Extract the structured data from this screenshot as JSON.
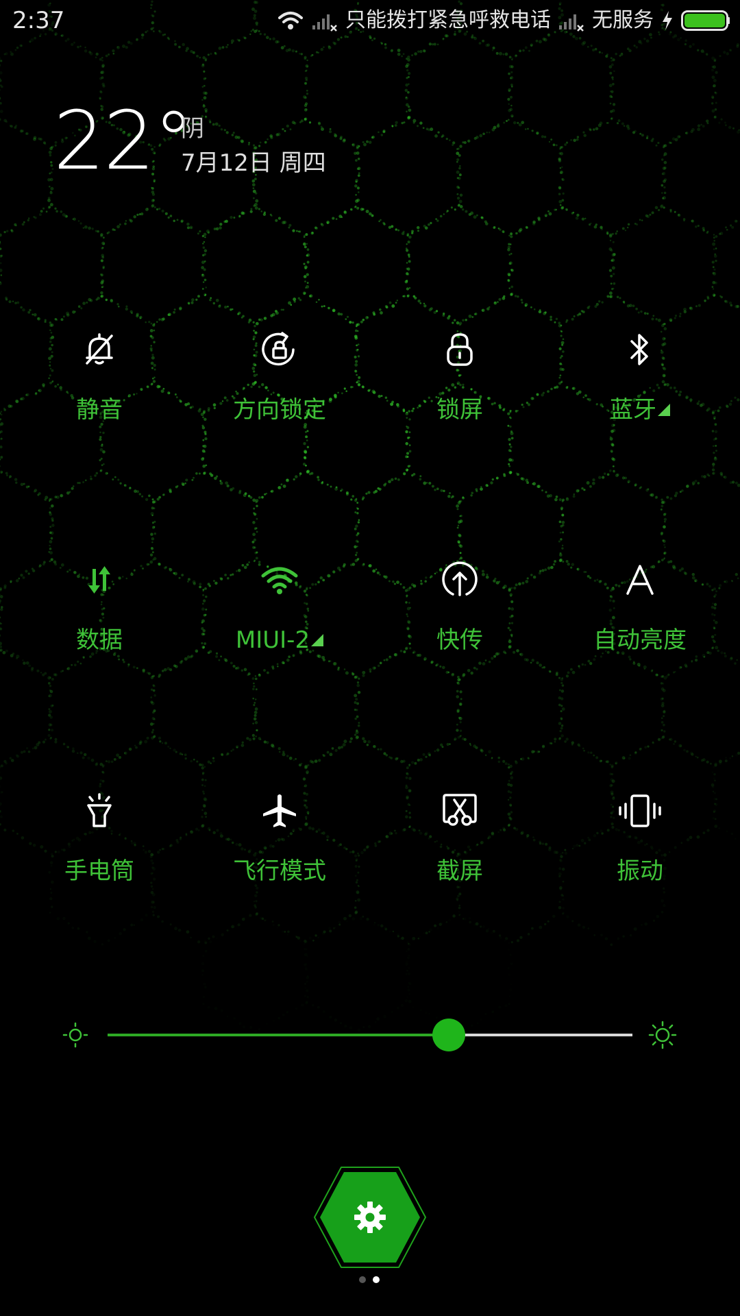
{
  "status_bar": {
    "time": "2:37",
    "carrier_text": "只能拨打紧急呼救电话",
    "service_text": "无服务",
    "battery_color": "#3cc11e"
  },
  "weather": {
    "temperature": "22°",
    "condition": "阴",
    "date": "7月12日 周四"
  },
  "toggles": [
    {
      "label": "静音",
      "icon": "bell-off-icon"
    },
    {
      "label": "方向锁定",
      "icon": "rotation-lock-icon"
    },
    {
      "label": "锁屏",
      "icon": "lock-icon"
    },
    {
      "label": "蓝牙",
      "icon": "bluetooth-icon",
      "has_menu": true
    },
    {
      "label": "数据",
      "icon": "mobile-data-icon",
      "active": true
    },
    {
      "label": "MIUI-2",
      "icon": "wifi-icon",
      "active": true,
      "has_menu": true
    },
    {
      "label": "快传",
      "icon": "quick-transfer-icon"
    },
    {
      "label": "自动亮度",
      "icon": "auto-brightness-icon"
    },
    {
      "label": "手电筒",
      "icon": "flashlight-icon"
    },
    {
      "label": "飞行模式",
      "icon": "airplane-icon"
    },
    {
      "label": "截屏",
      "icon": "screenshot-icon"
    },
    {
      "label": "振动",
      "icon": "vibrate-icon"
    }
  ],
  "brightness": {
    "level": 0.65
  },
  "settings_button": {
    "icon": "gear-icon",
    "color": "#17a01a"
  },
  "pager": {
    "pages": 2,
    "current": 2
  },
  "colors": {
    "accent": "#3fc238",
    "label_green": "#3fc238",
    "icon_white": "#ffffff"
  }
}
